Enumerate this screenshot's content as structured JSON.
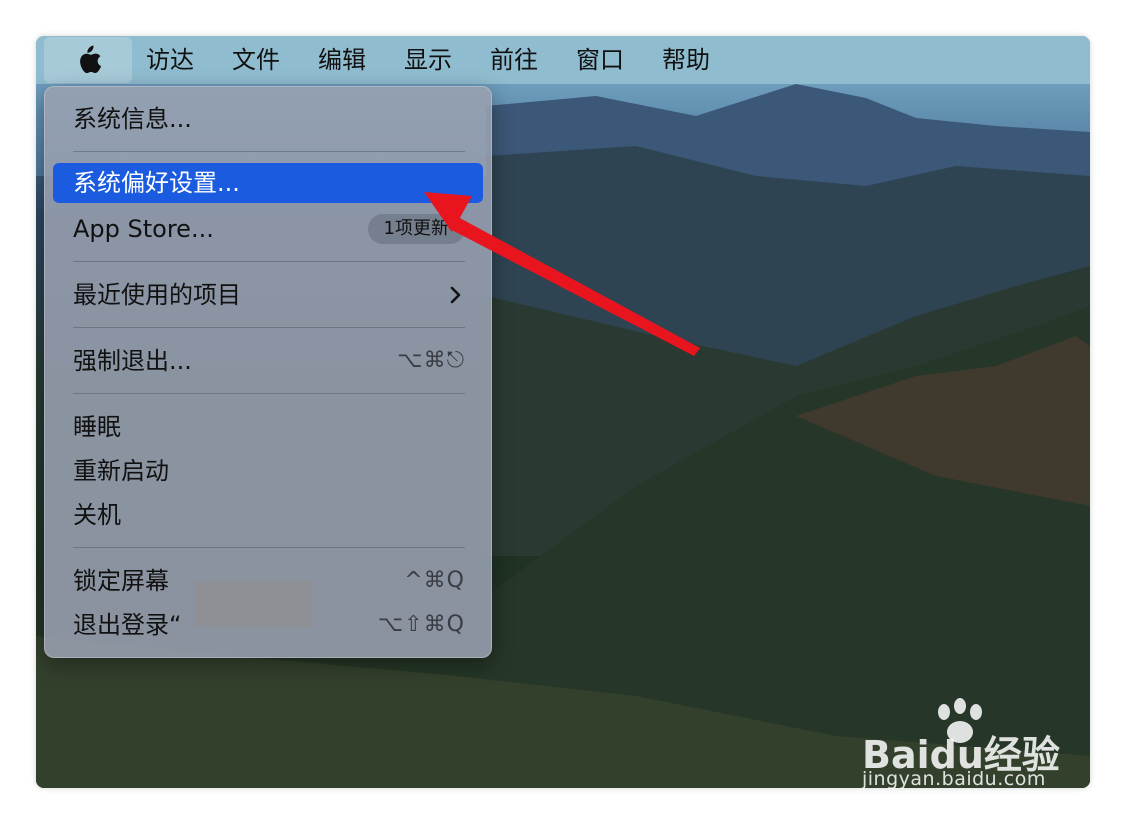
{
  "menubar": {
    "items": [
      "访达",
      "文件",
      "编辑",
      "显示",
      "前往",
      "窗口",
      "帮助"
    ]
  },
  "menu": {
    "about": "系统信息...",
    "system_prefs": "系统偏好设置...",
    "app_store": "App Store...",
    "app_store_badge": "1项更新",
    "recent_items": "最近使用的项目",
    "force_quit": "强制退出...",
    "force_quit_shortcut": "⌥⌘⎋",
    "sleep": "睡眠",
    "restart": "重新启动",
    "shutdown": "关机",
    "lock_screen": "锁定屏幕",
    "lock_screen_shortcut": "^⌘Q",
    "logout": "退出登录“",
    "logout_shortcut": "⌥⇧⌘Q"
  },
  "colors": {
    "selection": "#1a5be0",
    "annotation_arrow": "#e8141e"
  },
  "watermark": {
    "brand": "Baidu经验",
    "url": "jingyan.baidu.com"
  }
}
